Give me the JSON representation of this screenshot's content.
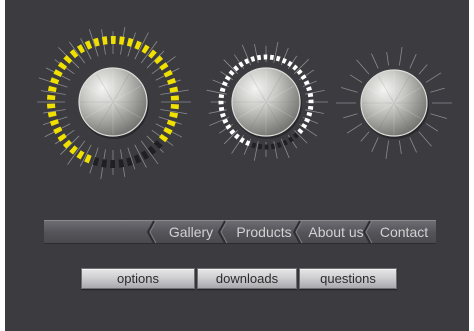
{
  "knobs": [
    {
      "name": "knob-large-yellow",
      "ring_color": "#f0e000",
      "ring_dim_color": "#202024",
      "level": 0.8
    },
    {
      "name": "knob-medium-white",
      "ring_color": "#ffffff",
      "ring_dim_color": "#202024",
      "level": 0.82
    },
    {
      "name": "knob-small-plain",
      "ring_color": "",
      "ring_dim_color": "",
      "level": 0
    }
  ],
  "nav": {
    "items": [
      {
        "label": "Gallery"
      },
      {
        "label": "Products"
      },
      {
        "label": "About us"
      },
      {
        "label": "Contact"
      }
    ]
  },
  "buttons": [
    {
      "label": "options"
    },
    {
      "label": "downloads"
    },
    {
      "label": "questions"
    }
  ],
  "colors": {
    "background": "#3b3b40",
    "nav_bar": "#59595e",
    "nav_text": "#d2d2d4",
    "button_text": "#2b2b2e"
  }
}
